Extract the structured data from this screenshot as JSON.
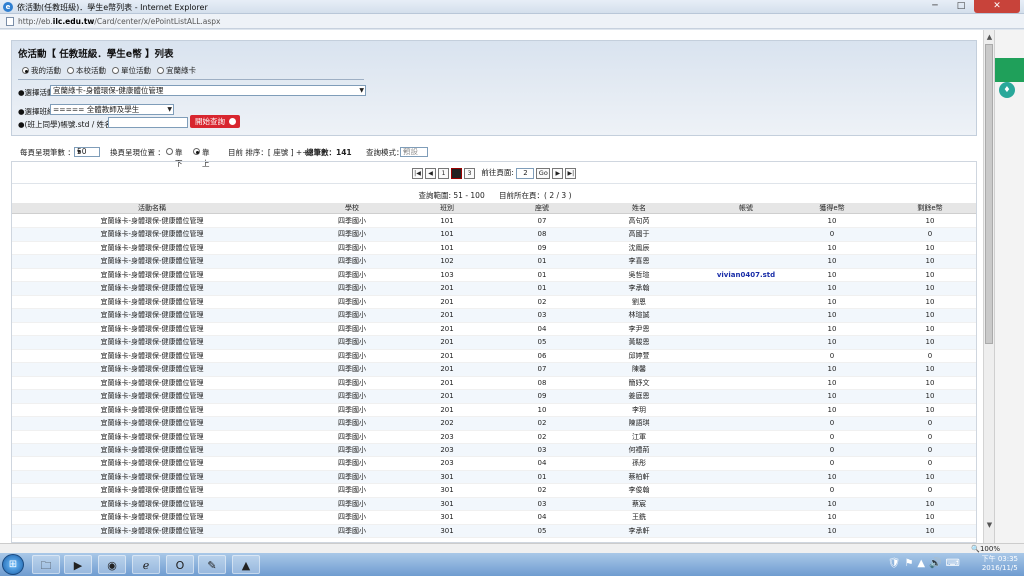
{
  "window": {
    "title": "依活動(任教班級)．學生e幣列表 - Internet Explorer",
    "url_prefix": "http://eb.",
    "url_host": "ilc.edu.tw",
    "url_path": "/Card/center/x/ePointListALL.aspx",
    "min": "─",
    "max": "□",
    "close": "✕"
  },
  "panel": {
    "title": "依活動【 任教班級．學生e幣 】列表",
    "radios": [
      {
        "label": "我的活動",
        "checked": true
      },
      {
        "label": "本校活動",
        "checked": false
      },
      {
        "label": "單位活動",
        "checked": false
      },
      {
        "label": "宜蘭綠卡",
        "checked": false
      }
    ],
    "activity_label": "●選擇活動",
    "activity_value": "宜蘭綠卡-身體環保-健康體位管理",
    "class_label": "●選擇班級",
    "class_value": "===== 全體教師及學生 =====",
    "account_label": "●(班上同學)帳號.std / 姓名：",
    "query_button": "開始查詢"
  },
  "options": {
    "per_page_label": "每頁呈現筆數 ：",
    "per_page_value": "50",
    "pager_pos_label": "換頁呈現位置 ：",
    "pos_down": "靠下",
    "pos_up": "靠上",
    "sort_text": "目前 排序：[ 座號 ] ++",
    "total_text": "總筆數：141",
    "mode_label": "查詢模式：",
    "mode_value": "預設"
  },
  "pager": {
    "pages": [
      "1",
      "2",
      "3"
    ],
    "current": "2",
    "goto_label": "前往頁面:",
    "goto_value": "2",
    "go": "Go",
    "range_text": "查詢範圍: 51 - 100",
    "page_text": "目前所在頁：( 2 / 3 )"
  },
  "columns": [
    "活動名稱",
    "學校",
    "班別",
    "座號",
    "姓名",
    "帳號",
    "獲得e幣",
    "剩餘e幣"
  ],
  "rows": [
    [
      "宜蘭綠卡-身體環保-健康體位管理",
      "四季國小",
      "101",
      "07",
      "高句芮",
      "",
      "10",
      "10"
    ],
    [
      "宜蘭綠卡-身體環保-健康體位管理",
      "四季國小",
      "101",
      "08",
      "高國于",
      "",
      "0",
      "0"
    ],
    [
      "宜蘭綠卡-身體環保-健康體位管理",
      "四季國小",
      "101",
      "09",
      "沈鳳辰",
      "",
      "10",
      "10"
    ],
    [
      "宜蘭綠卡-身體環保-健康體位管理",
      "四季國小",
      "102",
      "01",
      "李喜恩",
      "",
      "10",
      "10"
    ],
    [
      "宜蘭綠卡-身體環保-健康體位管理",
      "四季國小",
      "103",
      "01",
      "吳哲瑄",
      "vivian0407.std",
      "10",
      "10"
    ],
    [
      "宜蘭綠卡-身體環保-健康體位管理",
      "四季國小",
      "201",
      "01",
      "李承翰",
      "",
      "10",
      "10"
    ],
    [
      "宜蘭綠卡-身體環保-健康體位管理",
      "四季國小",
      "201",
      "02",
      "劉恩",
      "",
      "10",
      "10"
    ],
    [
      "宜蘭綠卡-身體環保-健康體位管理",
      "四季國小",
      "201",
      "03",
      "林瑄誠",
      "",
      "10",
      "10"
    ],
    [
      "宜蘭綠卡-身體環保-健康體位管理",
      "四季國小",
      "201",
      "04",
      "李尹恩",
      "",
      "10",
      "10"
    ],
    [
      "宜蘭綠卡-身體環保-健康體位管理",
      "四季國小",
      "201",
      "05",
      "黃駿恩",
      "",
      "10",
      "10"
    ],
    [
      "宜蘭綠卡-身體環保-健康體位管理",
      "四季國小",
      "201",
      "06",
      "邱婷萱",
      "",
      "0",
      "0"
    ],
    [
      "宜蘭綠卡-身體環保-健康體位管理",
      "四季國小",
      "201",
      "07",
      "陳馨",
      "",
      "10",
      "10"
    ],
    [
      "宜蘭綠卡-身體環保-健康體位管理",
      "四季國小",
      "201",
      "08",
      "簡妤文",
      "",
      "10",
      "10"
    ],
    [
      "宜蘭綠卡-身體環保-健康體位管理",
      "四季國小",
      "201",
      "09",
      "姜庭恩",
      "",
      "10",
      "10"
    ],
    [
      "宜蘭綠卡-身體環保-健康體位管理",
      "四季國小",
      "201",
      "10",
      "李玥",
      "",
      "10",
      "10"
    ],
    [
      "宜蘭綠卡-身體環保-健康體位管理",
      "四季國小",
      "202",
      "02",
      "陳語琪",
      "",
      "0",
      "0"
    ],
    [
      "宜蘭綠卡-身體環保-健康體位管理",
      "四季國小",
      "203",
      "02",
      "江軍",
      "",
      "0",
      "0"
    ],
    [
      "宜蘭綠卡-身體環保-健康體位管理",
      "四季國小",
      "203",
      "03",
      "何禮荊",
      "",
      "0",
      "0"
    ],
    [
      "宜蘭綠卡-身體環保-健康體位管理",
      "四季國小",
      "203",
      "04",
      "孫彤",
      "",
      "0",
      "0"
    ],
    [
      "宜蘭綠卡-身體環保-健康體位管理",
      "四季國小",
      "301",
      "01",
      "蔡柏軒",
      "",
      "10",
      "10"
    ],
    [
      "宜蘭綠卡-身體環保-健康體位管理",
      "四季國小",
      "301",
      "02",
      "李俊翰",
      "",
      "0",
      "0"
    ],
    [
      "宜蘭綠卡-身體環保-健康體位管理",
      "四季國小",
      "301",
      "03",
      "蔡宸",
      "",
      "10",
      "10"
    ],
    [
      "宜蘭綠卡-身體環保-健康體位管理",
      "四季國小",
      "301",
      "04",
      "王銑",
      "",
      "10",
      "10"
    ],
    [
      "宜蘭綠卡-身體環保-健康體位管理",
      "四季國小",
      "301",
      "05",
      "李承軒",
      "",
      "10",
      "10"
    ]
  ],
  "status": {
    "zoom": "🔍100%"
  },
  "taskbar": {
    "start": "⊞",
    "apps": [
      "🗀",
      "▶",
      "◉",
      "ℯ",
      "O",
      "✎",
      "▲"
    ],
    "tray": "🛡⚑▲🔊⌨",
    "time": "下午 03:35",
    "date": "2016/11/5"
  }
}
